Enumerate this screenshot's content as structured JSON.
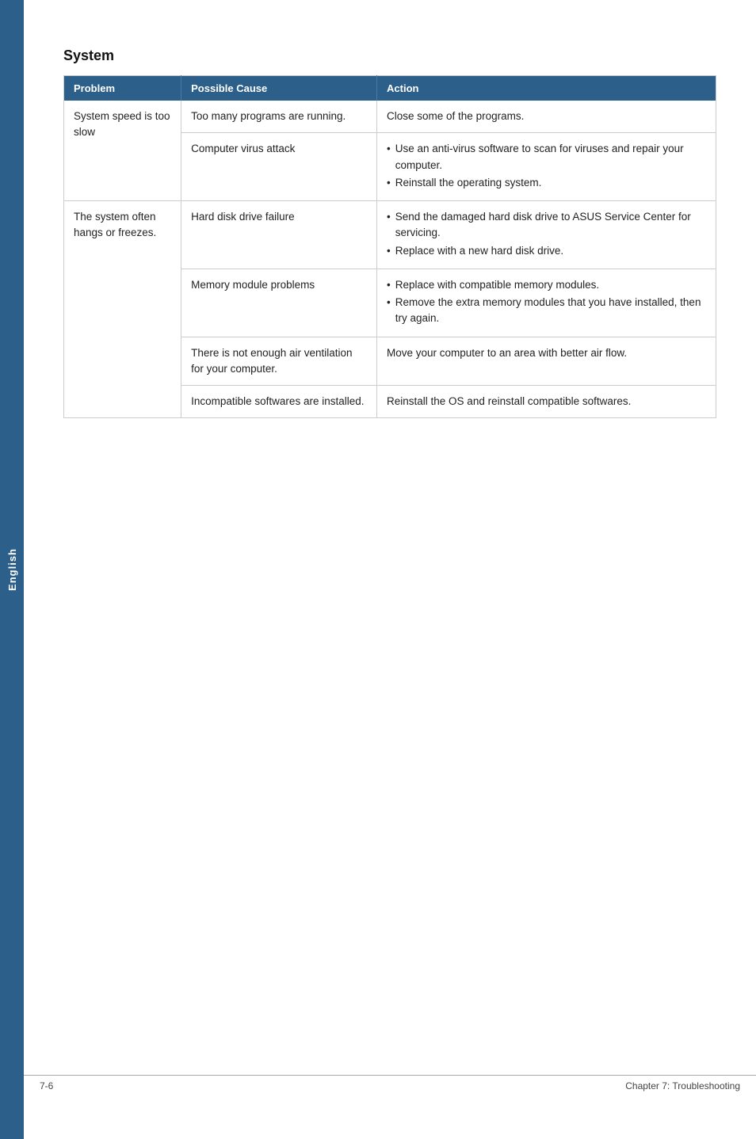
{
  "sidebar": {
    "label": "English"
  },
  "section": {
    "title": "System"
  },
  "table": {
    "headers": {
      "problem": "Problem",
      "cause": "Possible Cause",
      "action": "Action"
    },
    "rows": [
      {
        "problem": "System speed is too slow",
        "problem_rowspan": 2,
        "cause": "Too many programs are running.",
        "action_bullets": false,
        "action": "Close some of the programs."
      },
      {
        "problem": "",
        "cause": "Computer virus attack",
        "action_bullets": true,
        "action": [
          "Use an anti-virus software to scan for viruses and repair your computer.",
          "Reinstall the operating system."
        ]
      },
      {
        "problem": "The system often hangs or freezes.",
        "problem_rowspan": 4,
        "cause": "Hard disk drive failure",
        "action_bullets": true,
        "action": [
          "Send the damaged hard disk drive to ASUS Service Center for servicing.",
          "Replace with a new hard disk drive."
        ]
      },
      {
        "problem": "",
        "cause": "Memory module problems",
        "action_bullets": true,
        "action": [
          "Replace with compatible memory modules.",
          "Remove the extra memory modules that you have installed, then try again."
        ]
      },
      {
        "problem": "",
        "cause": "There is not enough air ventilation for your computer.",
        "action_bullets": false,
        "action": "Move your computer to an area with better air flow."
      },
      {
        "problem": "",
        "cause": "Incompatible softwares are installed.",
        "action_bullets": false,
        "action": "Reinstall the OS and reinstall compatible softwares."
      }
    ]
  },
  "footer": {
    "left": "7-6",
    "right": "Chapter 7: Troubleshooting"
  }
}
